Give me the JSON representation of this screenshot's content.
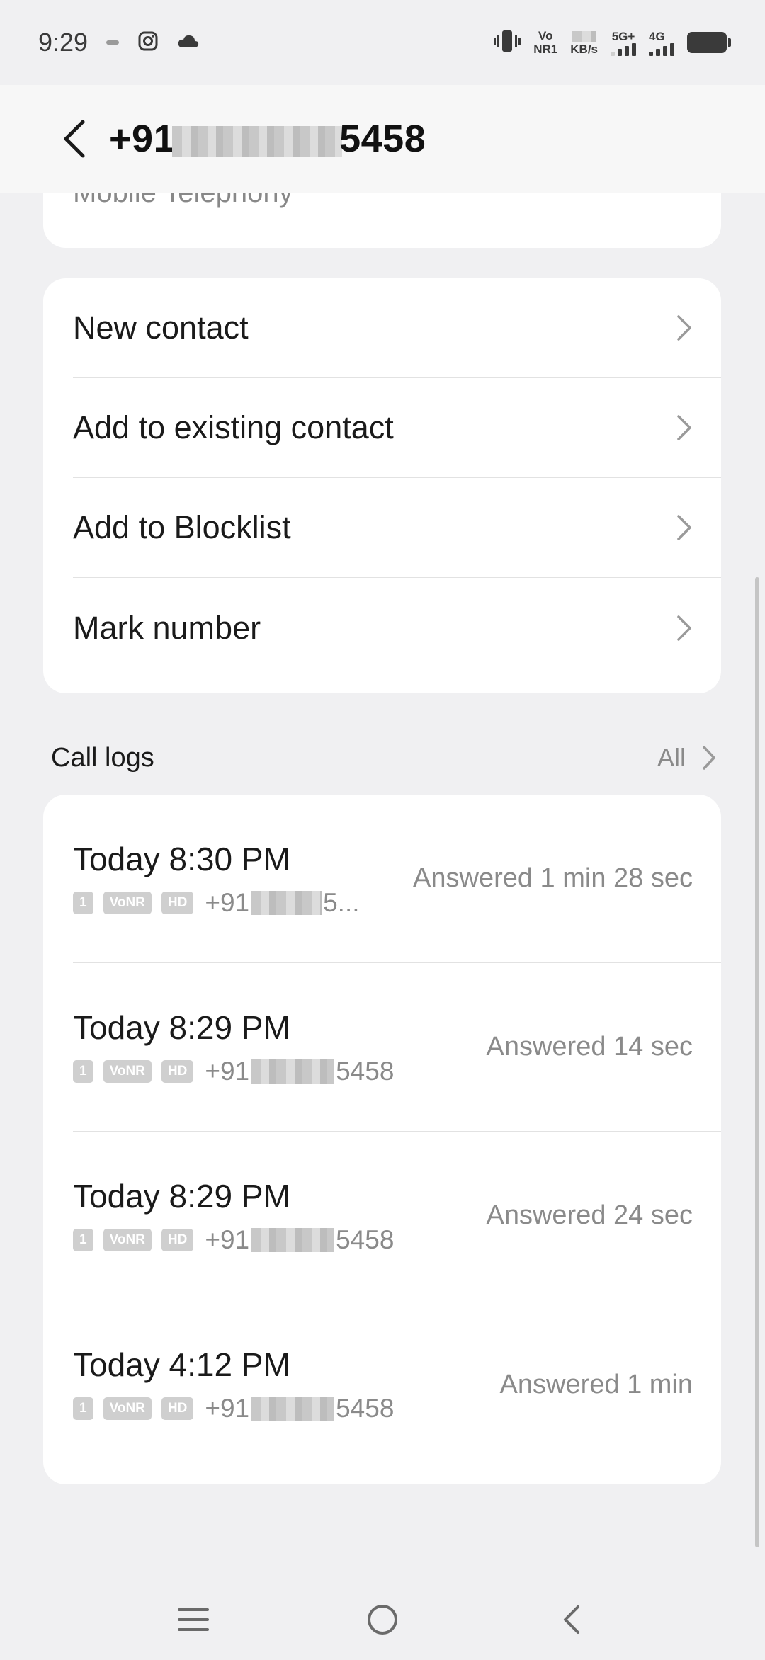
{
  "status_bar": {
    "time": "9:29",
    "volte": "Vo",
    "nr": "NR1",
    "speed_unit": "KB/s",
    "net1": "5G+",
    "net2": "4G"
  },
  "header": {
    "title_prefix": "+91",
    "title_suffix": "5458"
  },
  "partial_card": {
    "text": "Mobile Telephony"
  },
  "actions": [
    {
      "label": "New contact"
    },
    {
      "label": "Add to existing contact"
    },
    {
      "label": "Add to Blocklist"
    },
    {
      "label": "Mark number"
    }
  ],
  "call_logs": {
    "title": "Call logs",
    "all_label": "All",
    "entries": [
      {
        "time": "Today 8:30 PM",
        "sim": "1",
        "vonr": "VoNR",
        "hd": "HD",
        "num_prefix": "+91",
        "num_suffix": "5...",
        "status": "Answered 1 min 28 sec"
      },
      {
        "time": "Today 8:29 PM",
        "sim": "1",
        "vonr": "VoNR",
        "hd": "HD",
        "num_prefix": "+91",
        "num_suffix": "5458",
        "status": "Answered 14 sec"
      },
      {
        "time": "Today 8:29 PM",
        "sim": "1",
        "vonr": "VoNR",
        "hd": "HD",
        "num_prefix": "+91",
        "num_suffix": "5458",
        "status": "Answered 24 sec"
      },
      {
        "time": "Today 4:12 PM",
        "sim": "1",
        "vonr": "VoNR",
        "hd": "HD",
        "num_prefix": "+91",
        "num_suffix": "5458",
        "status": "Answered 1 min"
      }
    ]
  },
  "icons": {
    "back": "back-arrow-icon",
    "chevron": "chevron-right-icon",
    "nav_menu": "menu-icon",
    "nav_home": "home-icon",
    "nav_back": "back-icon"
  }
}
